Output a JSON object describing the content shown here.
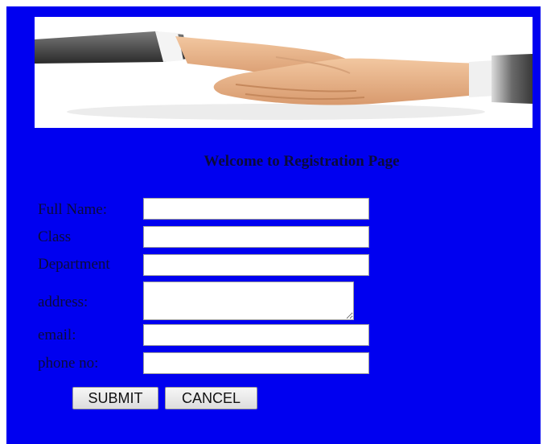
{
  "form": {
    "heading": "Welcome to Registration Page",
    "fields": [
      {
        "label": "Full Name:",
        "value": ""
      },
      {
        "label": "Class",
        "value": ""
      },
      {
        "label": "Department",
        "value": ""
      },
      {
        "label": "address:",
        "value": ""
      },
      {
        "label": "email:",
        "value": ""
      },
      {
        "label": "phone no:",
        "value": ""
      }
    ],
    "submit_label": "SUBMIT",
    "cancel_label": "CANCEL"
  },
  "banner": {
    "icon": "handshake-image"
  },
  "colors": {
    "background": "#0000f0",
    "label_text": "#0b0b3a"
  }
}
